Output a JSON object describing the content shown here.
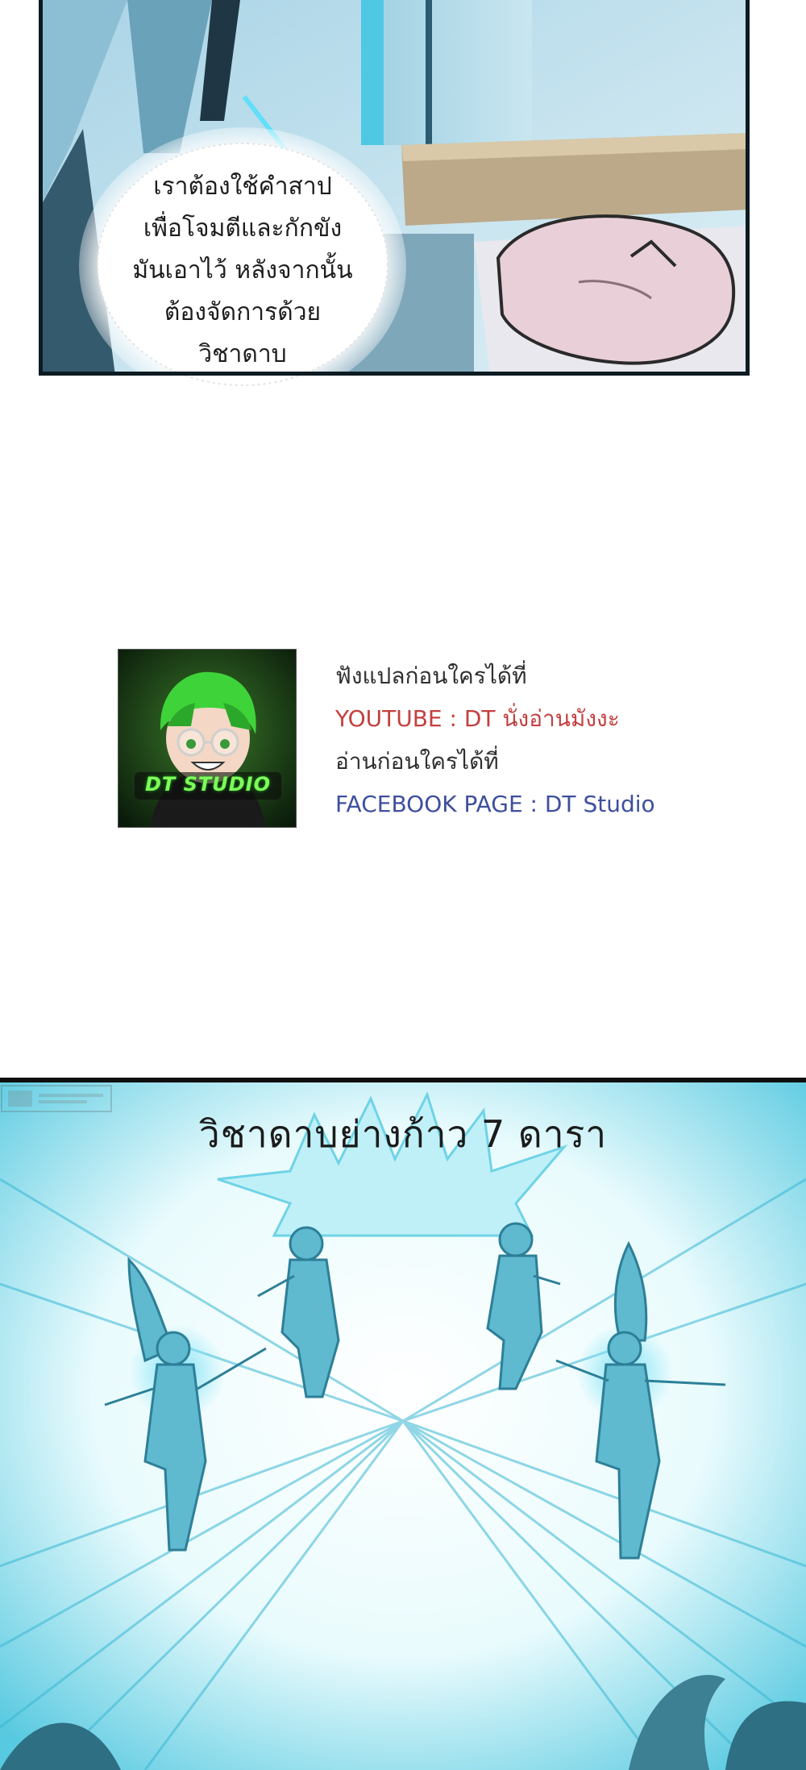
{
  "panel_top": {
    "speech_lines": [
      "เราต้องใช้คำสาป",
      "เพื่อโจมตีและกักขัง",
      "มันเอาไว้ หลังจากนั้น",
      "ต้องจัดการด้วย",
      "วิชาดาบ"
    ]
  },
  "credits": {
    "avatar_text": "DT STUDIO",
    "line1": "ฟังแปลก่อนใครได้ที่",
    "line2": "YOUTUBE : DT นั่งอ่านมังงะ",
    "line3": "อ่านก่อนใครได้ที่",
    "line4": "FACEBOOK PAGE : DT Studio",
    "colors": {
      "text": "#2f2f2f",
      "youtube": "#c3403f",
      "facebook": "#3e4f9c"
    }
  },
  "panel_bottom": {
    "title": "วิชาดาบย่างก้าว 7 ดารา",
    "accent_color": "#39b7d3"
  }
}
